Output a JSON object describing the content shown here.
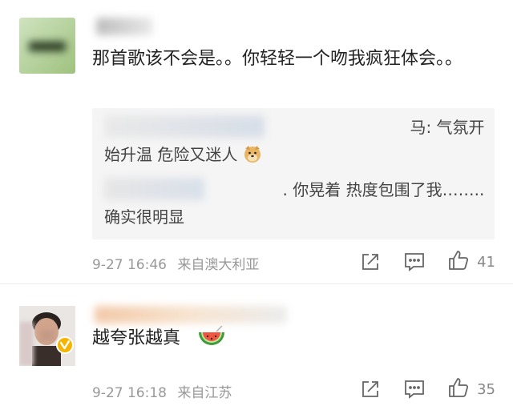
{
  "comments": [
    {
      "text": "那首歌该不会是。。你轻轻一个吻我疯狂体会。。",
      "replies": [
        {
          "text": "                                                            马: 气氛开始升温 危险又迷人"
        },
        {
          "text": "                                   . 你晃着 热度包围了我……..确实很明显"
        }
      ],
      "date": "9-27 16:46",
      "location": "来自澳大利亚",
      "likes": "41"
    },
    {
      "text": "越夸张越真",
      "date": "9-27 16:18",
      "location": "来自江苏",
      "likes": "35"
    }
  ],
  "icons": {
    "share": "share-icon",
    "comment": "comment-icon",
    "like": "thumbs-up-icon",
    "emoji_doge": "doge-emoji-icon",
    "emoji_watermelon": "watermelon-emoji-icon",
    "verified": "verified-badge-icon"
  },
  "colors": {
    "verified": "#f6b400",
    "quote_bg": "#f5f5f5",
    "meta": "#999999"
  }
}
